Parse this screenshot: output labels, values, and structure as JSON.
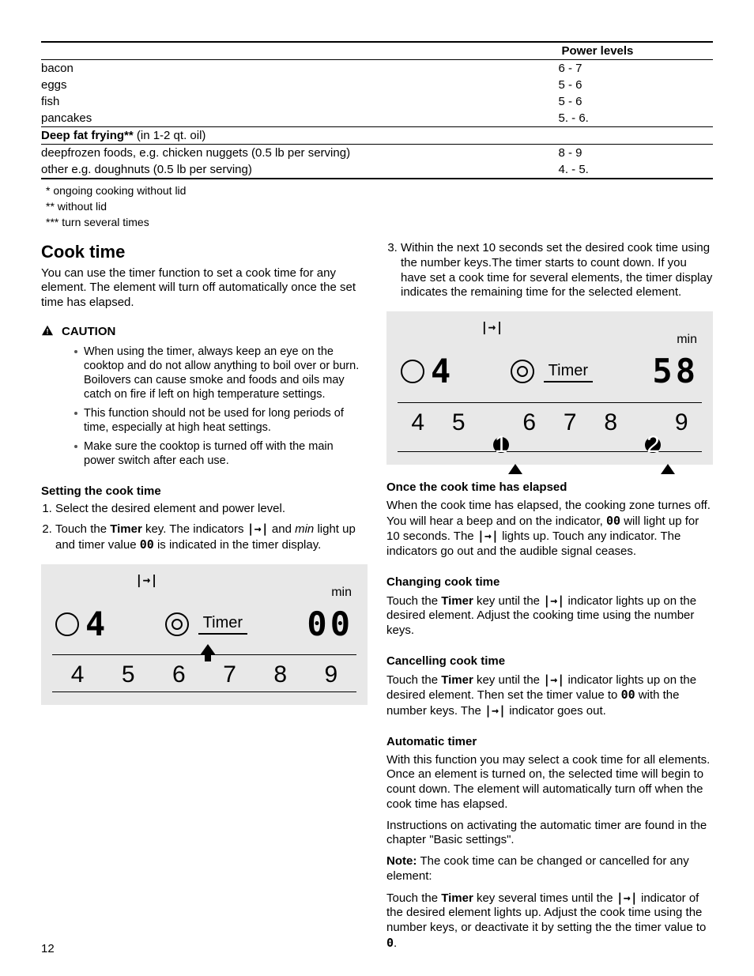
{
  "table": {
    "header_levels": "Power levels",
    "rows": [
      {
        "item": "bacon",
        "level": "6 - 7"
      },
      {
        "item": "eggs",
        "level": "5 - 6"
      },
      {
        "item": "fish",
        "level": "5 - 6"
      },
      {
        "item": "pancakes",
        "level": "5. - 6."
      }
    ],
    "category_label": "Deep fat frying**",
    "category_detail": " (in 1-2 qt. oil)",
    "cat_rows": [
      {
        "item": "deepfrozen foods, e.g. chicken nuggets (0.5 lb per serving)",
        "level": "8 - 9"
      },
      {
        "item": "other e.g. doughnuts (0.5 lb per serving)",
        "level": "4. - 5."
      }
    ],
    "notes": [
      "* ongoing cooking without lid",
      "** without lid",
      "*** turn several times"
    ]
  },
  "left": {
    "heading": "Cook time",
    "intro": "You can use the timer function to set a cook time for any element. The element will turn off automatically once the set time has elapsed.",
    "caution_label": "CAUTION",
    "caution_items": [
      "When using the timer, always keep an eye on the cooktop and do not allow anything to boil over or burn. Boilovers can cause smoke and foods and oils may catch on fire if left on high temperature settings.",
      "This function should not be used for long periods of time, especially at high heat settings.",
      "Make sure the cooktop is turned off with the main power switch after each use."
    ],
    "setting_head": "Setting the cook time",
    "step1": "Select the desired element and power level.",
    "step2_a": "Touch the ",
    "step2_timer": "Timer",
    "step2_b": " key. The indicators ",
    "step2_sym1": "|→|",
    "step2_c": " and ",
    "step2_min": "min",
    "step2_d": " light up and timer value ",
    "step2_zero": "00",
    "step2_e": " is indicated in the timer display."
  },
  "right": {
    "step3_a": "Within the next 10 seconds set the desired cook time using the number keys.",
    "step3_b": "The timer starts to count down. If you have set a cook time for several elements, the timer display indicates the remaining time for the selected element.",
    "elapsed_head": "Once the cook time has elapsed",
    "elapsed_a": "When the cook time has elapsed, the cooking zone turnes off. You will hear a beep and on the indicator, ",
    "elapsed_zero": "00",
    "elapsed_b": " will light up for 10 seconds. The ",
    "elapsed_sym": "|→|",
    "elapsed_c": " lights up. Touch any indicator. The indicators go out and the audible signal ceases.",
    "changing_head": "Changing cook time",
    "changing_a": "Touch the ",
    "changing_timer": "Timer",
    "changing_b": " key until the ",
    "changing_sym": "|→|",
    "changing_c": " indicator lights up on the desired element. Adjust the cooking time using the number keys.",
    "cancel_head": "Cancelling cook time",
    "cancel_a": "Touch the ",
    "cancel_timer": "Timer",
    "cancel_b": " key until the ",
    "cancel_sym": "|→|",
    "cancel_c": " indicator lights up on the desired element. Then set the timer value to ",
    "cancel_zero": "00",
    "cancel_d": " with the number keys. The ",
    "cancel_sym2": "|→|",
    "cancel_e": " indicator goes out.",
    "auto_head": "Automatic timer",
    "auto_p1": "With this function you may select a cook time for all elements. Once an element is turned on, the selected time will begin to count down. The element will automatically turn off when the cook time has elapsed.",
    "auto_p2": "Instructions on activating the automatic timer are found in the chapter \"Basic settings\".",
    "note_label": "Note: ",
    "note_body": " The cook time can be changed or cancelled for any element:",
    "note_p2_a": "Touch the ",
    "note_p2_timer": "Timer",
    "note_p2_b": " key several times until the ",
    "note_p2_sym": "|→|",
    "note_p2_c": " indicator of the desired element lights up. Adjust the cook time using the number keys, or deactivate it by setting the the timer value to ",
    "note_p2_zero": "0",
    "note_p2_d": "."
  },
  "fig1": {
    "indicator_sym": "|→|",
    "min": "min",
    "power": "4",
    "timer_label": "Timer",
    "digits": "00",
    "numbers": [
      "4",
      "5",
      "6",
      "7",
      "8",
      "9"
    ]
  },
  "fig2": {
    "indicator_sym": "|→|",
    "min": "min",
    "power": "4",
    "timer_label": "Timer",
    "digits": "58",
    "numbers": [
      "4",
      "5",
      "6",
      "7",
      "8",
      "9"
    ],
    "badge1": "1",
    "badge2": "2"
  },
  "page_number": "12"
}
